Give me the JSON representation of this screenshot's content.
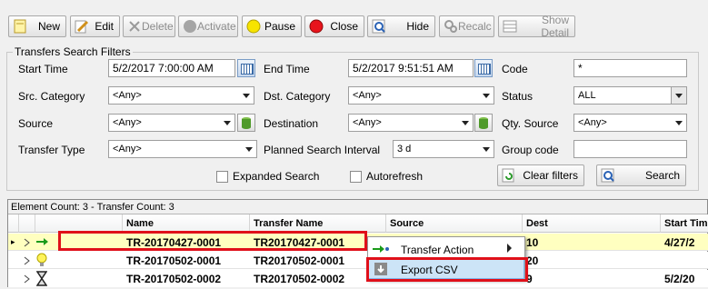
{
  "toolbar": {
    "new": "New",
    "edit": "Edit",
    "delete": "Delete",
    "activate": "Activate",
    "pause": "Pause",
    "close": "Close",
    "hide": "Hide",
    "recalc": "Recalc",
    "show_detail": "Show Detail"
  },
  "filters": {
    "legend": "Transfers Search Filters",
    "start_time_label": "Start Time",
    "start_time_value": "5/2/2017 7:00:00 AM",
    "end_time_label": "End Time",
    "end_time_value": "5/2/2017 9:51:51 AM",
    "code_label": "Code",
    "code_value": "*",
    "src_category_label": "Src. Category",
    "src_category_value": "<Any>",
    "dst_category_label": "Dst. Category",
    "dst_category_value": "<Any>",
    "status_label": "Status",
    "status_value": "ALL",
    "source_label": "Source",
    "source_value": "<Any>",
    "destination_label": "Destination",
    "destination_value": "<Any>",
    "qty_source_label": "Qty. Source",
    "qty_source_value": "<Any>",
    "transfer_type_label": "Transfer Type",
    "transfer_type_value": "<Any>",
    "planned_interval_label": "Planned Search Interval",
    "planned_interval_value": "3 d",
    "group_code_label": "Group code",
    "group_code_value": "",
    "expanded_search_label": "Expanded Search",
    "autorefresh_label": "Autorefresh",
    "clear_filters": "Clear filters",
    "search": "Search"
  },
  "grid": {
    "caption": "Element Count: 3 - Transfer Count: 3",
    "columns": [
      "Name",
      "Transfer Name",
      "Source",
      "Dest",
      "Start Tim"
    ],
    "rows": [
      {
        "name": "TR-20170427-0001",
        "transfer_name": "TR20170427-0001",
        "dest": "10",
        "start": "4/27/2"
      },
      {
        "name": "TR-20170502-0001",
        "transfer_name": "TR20170502-0001",
        "dest": "20",
        "start": ""
      },
      {
        "name": "TR-20170502-0002",
        "transfer_name": "TR20170502-0002",
        "dest": "9",
        "start": "5/2/20"
      }
    ]
  },
  "context_menu": {
    "transfer_action": "Transfer Action",
    "export_csv": "Export CSV"
  },
  "colors": {
    "selected_row": "#ffffc0",
    "highlight_red": "#e0101a",
    "menu_hover": "#cce4f7"
  }
}
